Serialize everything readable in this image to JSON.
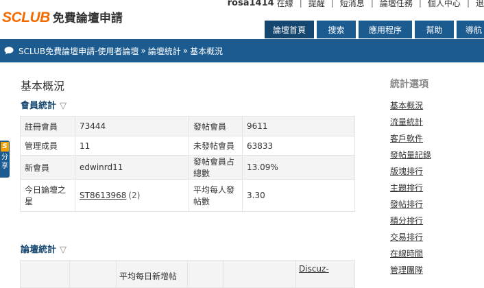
{
  "header": {
    "logo_brand": "SCLUB",
    "logo_text": "免費論壇申請",
    "username": "rosa1414",
    "user_links": [
      "在線",
      "提醒",
      "短消息",
      "論壇任務",
      "個人中心",
      "退"
    ]
  },
  "nav": {
    "tabs": [
      "論壇首頁",
      "搜索",
      "應用程序",
      "幫助",
      "導航"
    ]
  },
  "breadcrumb": {
    "items": [
      "SCLUB免費論壇申請-使用者論壇",
      "論壇統計",
      "基本概況"
    ],
    "separator": "»"
  },
  "side_float": {
    "logo": "S",
    "chars": [
      "分",
      "享"
    ]
  },
  "main": {
    "page_title": "基本概況",
    "member_section": {
      "title": "會員統計",
      "toggle": "▽",
      "rows": [
        {
          "label1": "註冊會員",
          "value1": "73444",
          "label2": "發帖會員",
          "value2": "9611"
        },
        {
          "label1": "管理成員",
          "value1": "11",
          "label2": "未發帖會員",
          "value2": "63833"
        },
        {
          "label1": "新會員",
          "value1": "edwinrd11",
          "label2": "發帖會員占總數",
          "value2": "13.09%"
        },
        {
          "label1": "今日論壇之星",
          "value1_link": "ST8613968",
          "value1_count": "(2)",
          "label2": "平均每人發帖數",
          "value2": "3.30"
        }
      ]
    },
    "forum_section": {
      "title": "論壇統計",
      "toggle": "▽",
      "partial_cell": "平均每日新增帖",
      "discuz_link": "Discuz-"
    }
  },
  "sidebar": {
    "title": "統計選項",
    "items": [
      "基本概況",
      "流量統計",
      "客戶軟件",
      "發帖量記錄",
      "版塊排行",
      "主題排行",
      "發帖排行",
      "積分排行",
      "交易排行",
      "在線時間",
      "管理團隊"
    ]
  }
}
